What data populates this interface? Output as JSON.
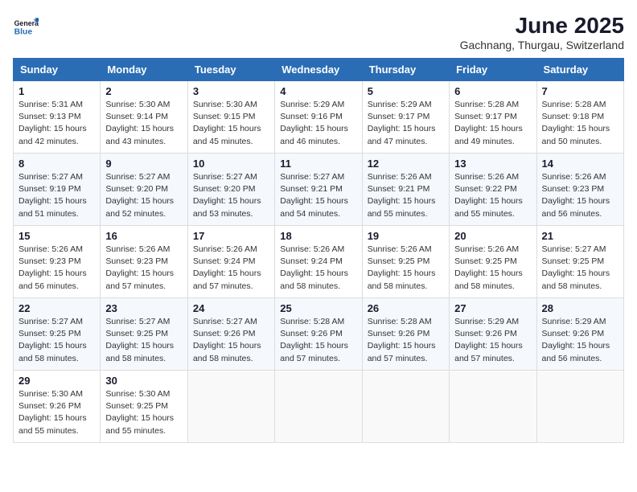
{
  "header": {
    "logo_general": "General",
    "logo_blue": "Blue",
    "month_year": "June 2025",
    "location": "Gachnang, Thurgau, Switzerland"
  },
  "columns": [
    "Sunday",
    "Monday",
    "Tuesday",
    "Wednesday",
    "Thursday",
    "Friday",
    "Saturday"
  ],
  "weeks": [
    [
      {
        "day": "1",
        "sunrise": "5:31 AM",
        "sunset": "9:13 PM",
        "daylight": "15 hours and 42 minutes."
      },
      {
        "day": "2",
        "sunrise": "5:30 AM",
        "sunset": "9:14 PM",
        "daylight": "15 hours and 43 minutes."
      },
      {
        "day": "3",
        "sunrise": "5:30 AM",
        "sunset": "9:15 PM",
        "daylight": "15 hours and 45 minutes."
      },
      {
        "day": "4",
        "sunrise": "5:29 AM",
        "sunset": "9:16 PM",
        "daylight": "15 hours and 46 minutes."
      },
      {
        "day": "5",
        "sunrise": "5:29 AM",
        "sunset": "9:17 PM",
        "daylight": "15 hours and 47 minutes."
      },
      {
        "day": "6",
        "sunrise": "5:28 AM",
        "sunset": "9:17 PM",
        "daylight": "15 hours and 49 minutes."
      },
      {
        "day": "7",
        "sunrise": "5:28 AM",
        "sunset": "9:18 PM",
        "daylight": "15 hours and 50 minutes."
      }
    ],
    [
      {
        "day": "8",
        "sunrise": "5:27 AM",
        "sunset": "9:19 PM",
        "daylight": "15 hours and 51 minutes."
      },
      {
        "day": "9",
        "sunrise": "5:27 AM",
        "sunset": "9:20 PM",
        "daylight": "15 hours and 52 minutes."
      },
      {
        "day": "10",
        "sunrise": "5:27 AM",
        "sunset": "9:20 PM",
        "daylight": "15 hours and 53 minutes."
      },
      {
        "day": "11",
        "sunrise": "5:27 AM",
        "sunset": "9:21 PM",
        "daylight": "15 hours and 54 minutes."
      },
      {
        "day": "12",
        "sunrise": "5:26 AM",
        "sunset": "9:21 PM",
        "daylight": "15 hours and 55 minutes."
      },
      {
        "day": "13",
        "sunrise": "5:26 AM",
        "sunset": "9:22 PM",
        "daylight": "15 hours and 55 minutes."
      },
      {
        "day": "14",
        "sunrise": "5:26 AM",
        "sunset": "9:23 PM",
        "daylight": "15 hours and 56 minutes."
      }
    ],
    [
      {
        "day": "15",
        "sunrise": "5:26 AM",
        "sunset": "9:23 PM",
        "daylight": "15 hours and 56 minutes."
      },
      {
        "day": "16",
        "sunrise": "5:26 AM",
        "sunset": "9:23 PM",
        "daylight": "15 hours and 57 minutes."
      },
      {
        "day": "17",
        "sunrise": "5:26 AM",
        "sunset": "9:24 PM",
        "daylight": "15 hours and 57 minutes."
      },
      {
        "day": "18",
        "sunrise": "5:26 AM",
        "sunset": "9:24 PM",
        "daylight": "15 hours and 58 minutes."
      },
      {
        "day": "19",
        "sunrise": "5:26 AM",
        "sunset": "9:25 PM",
        "daylight": "15 hours and 58 minutes."
      },
      {
        "day": "20",
        "sunrise": "5:26 AM",
        "sunset": "9:25 PM",
        "daylight": "15 hours and 58 minutes."
      },
      {
        "day": "21",
        "sunrise": "5:27 AM",
        "sunset": "9:25 PM",
        "daylight": "15 hours and 58 minutes."
      }
    ],
    [
      {
        "day": "22",
        "sunrise": "5:27 AM",
        "sunset": "9:25 PM",
        "daylight": "15 hours and 58 minutes."
      },
      {
        "day": "23",
        "sunrise": "5:27 AM",
        "sunset": "9:25 PM",
        "daylight": "15 hours and 58 minutes."
      },
      {
        "day": "24",
        "sunrise": "5:27 AM",
        "sunset": "9:26 PM",
        "daylight": "15 hours and 58 minutes."
      },
      {
        "day": "25",
        "sunrise": "5:28 AM",
        "sunset": "9:26 PM",
        "daylight": "15 hours and 57 minutes."
      },
      {
        "day": "26",
        "sunrise": "5:28 AM",
        "sunset": "9:26 PM",
        "daylight": "15 hours and 57 minutes."
      },
      {
        "day": "27",
        "sunrise": "5:29 AM",
        "sunset": "9:26 PM",
        "daylight": "15 hours and 57 minutes."
      },
      {
        "day": "28",
        "sunrise": "5:29 AM",
        "sunset": "9:26 PM",
        "daylight": "15 hours and 56 minutes."
      }
    ],
    [
      {
        "day": "29",
        "sunrise": "5:30 AM",
        "sunset": "9:26 PM",
        "daylight": "15 hours and 55 minutes."
      },
      {
        "day": "30",
        "sunrise": "5:30 AM",
        "sunset": "9:25 PM",
        "daylight": "15 hours and 55 minutes."
      },
      null,
      null,
      null,
      null,
      null
    ]
  ]
}
